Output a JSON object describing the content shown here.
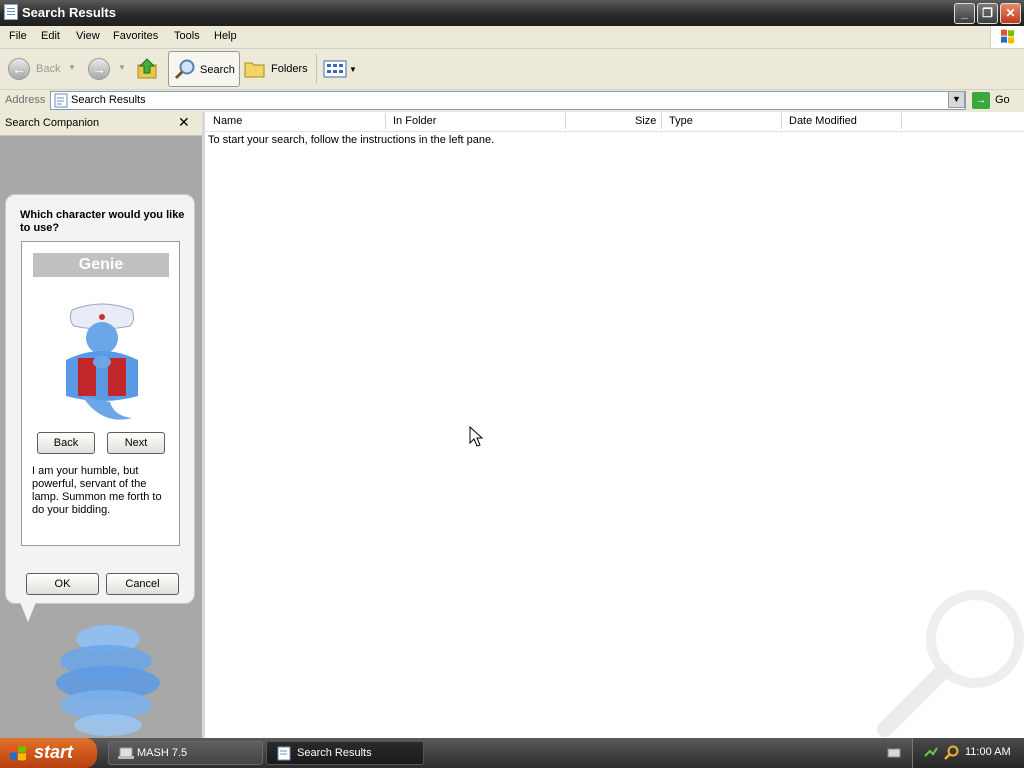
{
  "window": {
    "title": "Search Results"
  },
  "menubar": {
    "items": [
      "File",
      "Edit",
      "View",
      "Favorites",
      "Tools",
      "Help"
    ]
  },
  "toolbar": {
    "back_label": "Back",
    "search_label": "Search",
    "folders_label": "Folders"
  },
  "addressbar": {
    "label": "Address",
    "value": "Search Results",
    "go_label": "Go"
  },
  "leftpane": {
    "header": "Search Companion",
    "question": "Which character would you like to use?",
    "character_name": "Genie",
    "back_label": "Back",
    "next_label": "Next",
    "description": "I am your humble, but powerful, servant of the lamp. Summon me forth to do your bidding.",
    "ok_label": "OK",
    "cancel_label": "Cancel"
  },
  "content": {
    "columns": [
      "Name",
      "In Folder",
      "Size",
      "Type",
      "Date Modified"
    ],
    "message": "To start your search, follow the instructions in the left pane."
  },
  "taskbar": {
    "start_label": "start",
    "tasks": [
      "MASH 7.5",
      "Search Results"
    ],
    "clock": "11:00 AM"
  },
  "colors": {
    "accent": "#1f5fd1",
    "title_bar": "#2c2c2c",
    "start": "#c8501a"
  }
}
